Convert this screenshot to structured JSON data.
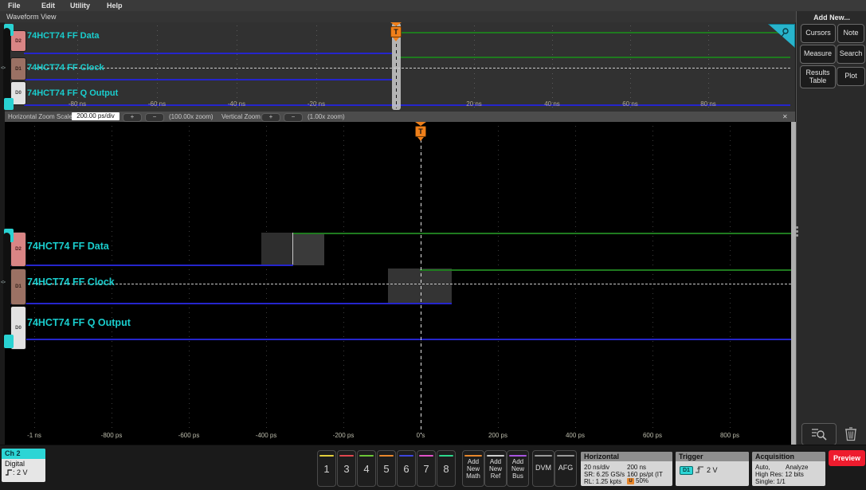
{
  "window": {
    "menu": [
      "File",
      "Edit",
      "Utility",
      "Help"
    ],
    "view_tab": "Waveform View"
  },
  "channels": [
    {
      "badge": "D2",
      "label": "74HCT74 FF Data"
    },
    {
      "badge": "D1",
      "label": "74HCT74 FF Clock"
    },
    {
      "badge": "D0",
      "label": "74HCT74 FF Q Output"
    }
  ],
  "overview": {
    "ticks": [
      "-80 ns",
      "-60 ns",
      "-40 ns",
      "-20 ns",
      "20 ns",
      "40 ns",
      "60 ns",
      "80 ns"
    ]
  },
  "zoombar": {
    "h_label": "Horizontal Zoom Scale",
    "h_scale": "200.00 ps/div",
    "plus": "+",
    "minus": "−",
    "h_zoom": "(100.00x zoom)",
    "v_label": "Vertical Zoom",
    "v_zoom": "(1.00x zoom)",
    "close": "✕"
  },
  "zoom_view": {
    "ticks": [
      "-1 ns",
      "-800 ps",
      "-600 ps",
      "-400 ps",
      "-200 ps",
      "0 s",
      "200 ps",
      "400 ps",
      "600 ps",
      "800 ps"
    ]
  },
  "markers": {
    "trigger_label": "T",
    "trigger_source": "<>"
  },
  "right_panel": {
    "title": "Add New...",
    "buttons": [
      "Cursors",
      "Note",
      "Measure",
      "Search",
      "Results Table",
      "Plot"
    ]
  },
  "bottom": {
    "ch2": {
      "title": "Ch 2",
      "mode": "Digital",
      "threshold": ": 2 V"
    },
    "channel_buttons": [
      {
        "label": "1",
        "color": "#e3cf3c"
      },
      {
        "label": "3",
        "color": "#e0474e"
      },
      {
        "label": "4",
        "color": "#6cc637"
      },
      {
        "label": "5",
        "color": "#e8872c"
      },
      {
        "label": "6",
        "color": "#3d46dd"
      },
      {
        "label": "7",
        "color": "#e052c8"
      },
      {
        "label": "8",
        "color": "#2cd88c"
      }
    ],
    "add_buttons": [
      {
        "label": "Add New Math",
        "color": "#e8872c"
      },
      {
        "label": "Add New Ref",
        "color": "#cfcfcf"
      },
      {
        "label": "Add New Bus",
        "color": "#a855e0"
      }
    ],
    "dvm": "DVM",
    "afg": "AFG",
    "horizontal": {
      "title": "Horizontal",
      "left": [
        "20 ns/div",
        "SR: 6.25 GS/s",
        "RL: 1.25 kpts"
      ],
      "right": [
        "200 ns",
        "160 ps/pt (IT",
        "50%"
      ],
      "u_badge": "U"
    },
    "trigger": {
      "title": "Trigger",
      "source": "D1",
      "level": "2 V"
    },
    "acquisition": {
      "title": "Acquisition",
      "row1_left": "Auto,",
      "row1_right": "Analyze",
      "row2": "High Res: 12 bits",
      "row3": "Single: 1/1"
    },
    "preview": "Preview"
  },
  "signals": {
    "overview": [
      {
        "name": "74HCT74 FF Data",
        "state": "low before 0 ns, high after 0 ns"
      },
      {
        "name": "74HCT74 FF Clock",
        "state": "low before 0 ns, high after 0 ns (trigger source, rising edge at 0 ns)"
      },
      {
        "name": "74HCT74 FF Q Output",
        "state": "low for entire record"
      }
    ],
    "zoom": [
      {
        "name": "74HCT74 FF Data",
        "state": "rises low→high near -330 ps, transition region ≈ -410 ps to -250 ps"
      },
      {
        "name": "74HCT74 FF Clock",
        "state": "rises low→high at 0 s, transition region ≈ -85 ps to +80 ps"
      },
      {
        "name": "74HCT74 FF Q Output",
        "state": "low for entire window"
      }
    ]
  },
  "colors": {
    "accent_cyan": "#2cd5d5",
    "trigger_orange": "#ef7f1a",
    "low_blue": "#2525cc",
    "high_green": "#1f7a1f",
    "preview_red": "#ee1c2e",
    "badge_d2": "#d98585",
    "badge_d1": "#9b7164",
    "badge_d0": "#e2e2e2"
  }
}
